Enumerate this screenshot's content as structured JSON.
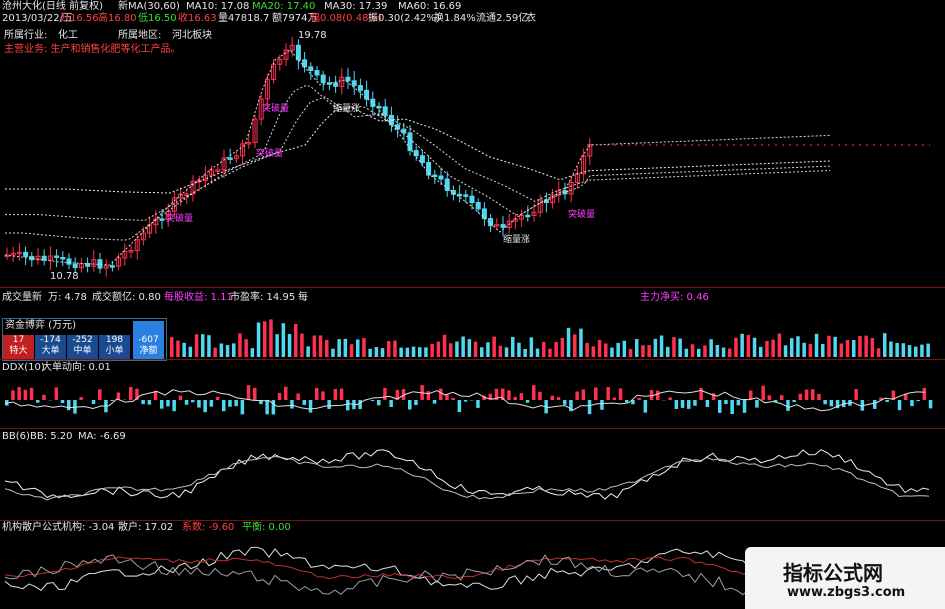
{
  "header": {
    "stock_name": "沧州大化(日线 前复权)",
    "ma_label": "新MA(30,60)",
    "ma10": "MA10: 17.08",
    "ma20": "MA20: 17.40",
    "ma30": "MA30: 17.39",
    "ma60": "MA60: 16.69",
    "date": "2013/03/22/五",
    "open": "开16.56",
    "high": "高16.80",
    "low": "低16.50",
    "close": "收16.63",
    "volume": "量47818.7",
    "amount": "额7974万",
    "change": "幅0.08(0.48%)",
    "amplitude": "振0.30(2.42%)",
    "turnover": "换1.84%",
    "float_cap": "流通2.59亿",
    "suffix": "衣",
    "industry_label": "所属行业:",
    "industry_value": "化工",
    "region_label": "所属地区:",
    "region_value": "河北板块",
    "business": "主营业务:  生产和销售化肥等化工产品。",
    "high_price": "19.78",
    "low_price": "10.78",
    "breakout_label": "突破量",
    "shrink_label": "缩量涨"
  },
  "volume_panel": {
    "title": "成交量新",
    "unit_val": "万: 4.78",
    "amount_val": "成交额亿: 0.80",
    "eps": "每股收益: 1.11",
    "pe": "市盈率: 14.95",
    "pe_suffix": "每",
    "main_net": "主力净买: 0.46",
    "fund_title": "资金博弈 (万元)",
    "fund_cells": [
      {
        "top": "17",
        "label": "特大"
      },
      {
        "top": "-174",
        "label": "大单"
      },
      {
        "top": "-252",
        "label": "中单"
      },
      {
        "top": "198",
        "label": "小单"
      },
      {
        "top": "-607",
        "label": "净额"
      }
    ]
  },
  "ddx_panel": {
    "title": "DDX(10)",
    "metric": "大单动向: 0.01"
  },
  "bb_panel": {
    "title": "BB(6)",
    "bb": "BB: 5.20",
    "ma": "MA: -6.69"
  },
  "inst_panel": {
    "title": "机构散户公式",
    "inst": "机构: -3.04",
    "retail": "散户: 17.02",
    "coef": "系数: -9.60",
    "balance": "平衡: 0.00"
  },
  "watermark": {
    "title": "指标公式网",
    "url": "www.zbgs3.com"
  },
  "colors": {
    "up": "#ff3050",
    "down": "#50d8f0",
    "ma": "#d8d8d8",
    "separator": "#7a1010"
  }
}
